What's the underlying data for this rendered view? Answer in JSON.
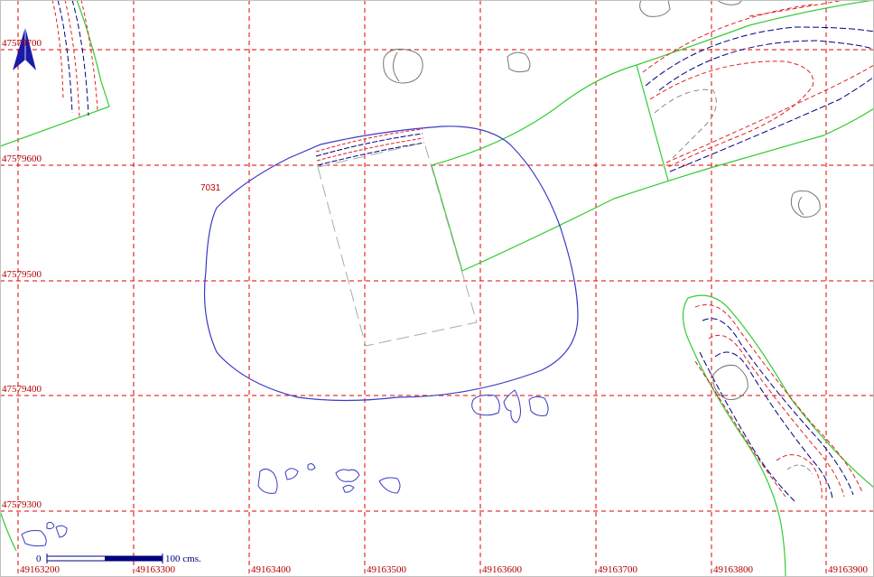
{
  "grid": {
    "easting_labels": [
      "49163200",
      "49163300",
      "49163400",
      "49163500",
      "49163600",
      "49163700",
      "49163800",
      "49163900"
    ],
    "northing_labels": [
      "47579700",
      "47579600",
      "47579500",
      "47579400",
      "47579300"
    ]
  },
  "feature": {
    "label": "7031"
  },
  "scale_bar": {
    "start": "0",
    "end": "100 cms."
  },
  "colors": {
    "grid": "#e00000",
    "pit_outline": "#3a3ac8",
    "trench_edge": "#33cc33",
    "contour_blue": "#000080",
    "contour_red": "#e02020",
    "stones": "#777777",
    "north_arrow": "#1a1aa8"
  },
  "icons": {
    "north_arrow": "north-arrow-icon"
  }
}
